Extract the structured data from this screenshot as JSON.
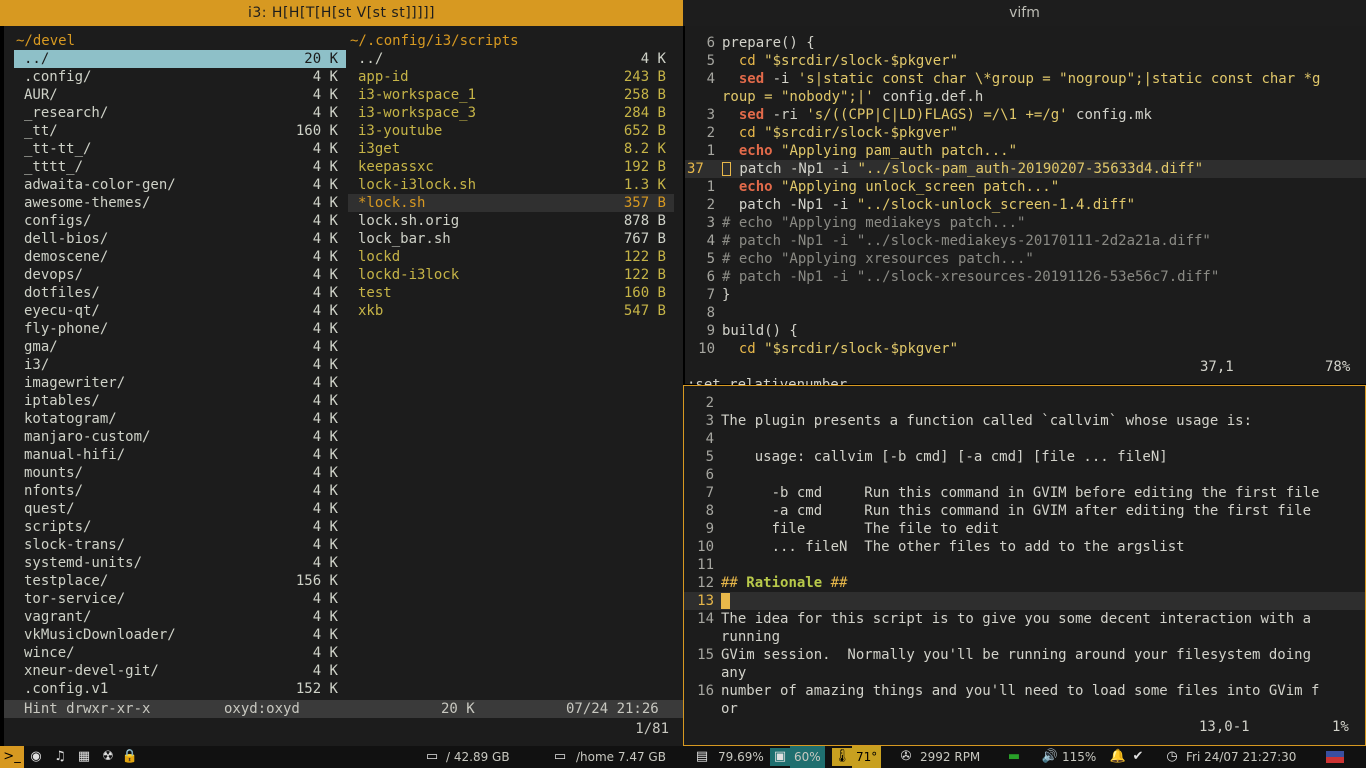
{
  "titles": {
    "left": "i3: H[H[T[H[st V[st st]]]]]",
    "right": "vifm"
  },
  "vifm": {
    "left_path": "~/devel",
    "left_files": [
      {
        "name": "../",
        "size": "20 K",
        "kind": "sel"
      },
      {
        "name": ".config/",
        "size": "4 K",
        "kind": "dir"
      },
      {
        "name": "AUR/",
        "size": "4 K",
        "kind": "dir"
      },
      {
        "name": "_research/",
        "size": "4 K",
        "kind": "dir"
      },
      {
        "name": "_tt/",
        "size": "160 K",
        "kind": "dir"
      },
      {
        "name": "_tt-tt_/",
        "size": "4 K",
        "kind": "dir"
      },
      {
        "name": "_tttt_/",
        "size": "4 K",
        "kind": "dir"
      },
      {
        "name": "adwaita-color-gen/",
        "size": "4 K",
        "kind": "dir"
      },
      {
        "name": "awesome-themes/",
        "size": "4 K",
        "kind": "dir"
      },
      {
        "name": "configs/",
        "size": "4 K",
        "kind": "dir"
      },
      {
        "name": "dell-bios/",
        "size": "4 K",
        "kind": "dir"
      },
      {
        "name": "demoscene/",
        "size": "4 K",
        "kind": "dir"
      },
      {
        "name": "devops/",
        "size": "4 K",
        "kind": "dir"
      },
      {
        "name": "dotfiles/",
        "size": "4 K",
        "kind": "dir"
      },
      {
        "name": "eyecu-qt/",
        "size": "4 K",
        "kind": "dir"
      },
      {
        "name": "fly-phone/",
        "size": "4 K",
        "kind": "dir"
      },
      {
        "name": "gma/",
        "size": "4 K",
        "kind": "dir"
      },
      {
        "name": "i3/",
        "size": "4 K",
        "kind": "dir"
      },
      {
        "name": "imagewriter/",
        "size": "4 K",
        "kind": "dir"
      },
      {
        "name": "iptables/",
        "size": "4 K",
        "kind": "dir"
      },
      {
        "name": "kotatogram/",
        "size": "4 K",
        "kind": "dir"
      },
      {
        "name": "manjaro-custom/",
        "size": "4 K",
        "kind": "dir"
      },
      {
        "name": "manual-hifi/",
        "size": "4 K",
        "kind": "dir"
      },
      {
        "name": "mounts/",
        "size": "4 K",
        "kind": "dir"
      },
      {
        "name": "nfonts/",
        "size": "4 K",
        "kind": "dir"
      },
      {
        "name": "quest/",
        "size": "4 K",
        "kind": "dir"
      },
      {
        "name": "scripts/",
        "size": "4 K",
        "kind": "dir"
      },
      {
        "name": "slock-trans/",
        "size": "4 K",
        "kind": "dir"
      },
      {
        "name": "systemd-units/",
        "size": "4 K",
        "kind": "dir"
      },
      {
        "name": "testplace/",
        "size": "156 K",
        "kind": "dir"
      },
      {
        "name": "tor-service/",
        "size": "4 K",
        "kind": "dir"
      },
      {
        "name": "vagrant/",
        "size": "4 K",
        "kind": "dir"
      },
      {
        "name": "vkMusicDownloader/",
        "size": "4 K",
        "kind": "dir"
      },
      {
        "name": "wince/",
        "size": "4 K",
        "kind": "dir"
      },
      {
        "name": "xneur-devel-git/",
        "size": "4 K",
        "kind": "dir"
      },
      {
        "name": ".config.v1",
        "size": "152 K",
        "kind": "dir"
      }
    ],
    "right_path": "~/.config/i3/scripts",
    "right_files": [
      {
        "name": "../",
        "size": "4 K",
        "kind": "dir"
      },
      {
        "name": "app-id",
        "size": "243 B",
        "kind": "file"
      },
      {
        "name": "i3-workspace_1",
        "size": "258 B",
        "kind": "file"
      },
      {
        "name": "i3-workspace_3",
        "size": "284 B",
        "kind": "file"
      },
      {
        "name": "i3-youtube",
        "size": "652 B",
        "kind": "file"
      },
      {
        "name": "i3get",
        "size": "8.2 K",
        "kind": "file"
      },
      {
        "name": "keepassxc",
        "size": "192 B",
        "kind": "file"
      },
      {
        "name": "lock-i3lock.sh",
        "size": "1.3 K",
        "kind": "file"
      },
      {
        "name": "*lock.sh",
        "size": "357 B",
        "kind": "cur"
      },
      {
        "name": "lock.sh.orig",
        "size": "878 B",
        "kind": "orig"
      },
      {
        "name": "lock_bar.sh",
        "size": "767 B",
        "kind": "orig"
      },
      {
        "name": "lockd",
        "size": "122 B",
        "kind": "file"
      },
      {
        "name": "lockd-i3lock",
        "size": "122 B",
        "kind": "file"
      },
      {
        "name": "test",
        "size": "160 B",
        "kind": "file"
      },
      {
        "name": "xkb",
        "size": "547 B",
        "kind": "file"
      }
    ],
    "status": {
      "hint": "Hint drwxr-xr-x",
      "owner": "oxyd:oxyd",
      "size": "20 K",
      "date": "07/24 21:26"
    },
    "position": "1/81"
  },
  "editor_top": {
    "cmdline": ":set relativenumber",
    "cursor": "37,1",
    "percent": "78%"
  },
  "editor_bottom": {
    "cursor": "13,0-1",
    "percent": "1%"
  },
  "taskbar": {
    "disk_root": "42.89 GB",
    "disk_home": "/home 7.47 GB",
    "mem": "79.69%",
    "cpu": "60%",
    "temp": "71°",
    "fan": "2992 RPM",
    "volume": "115%",
    "clock": "Fri 24/07 21:27:30"
  }
}
